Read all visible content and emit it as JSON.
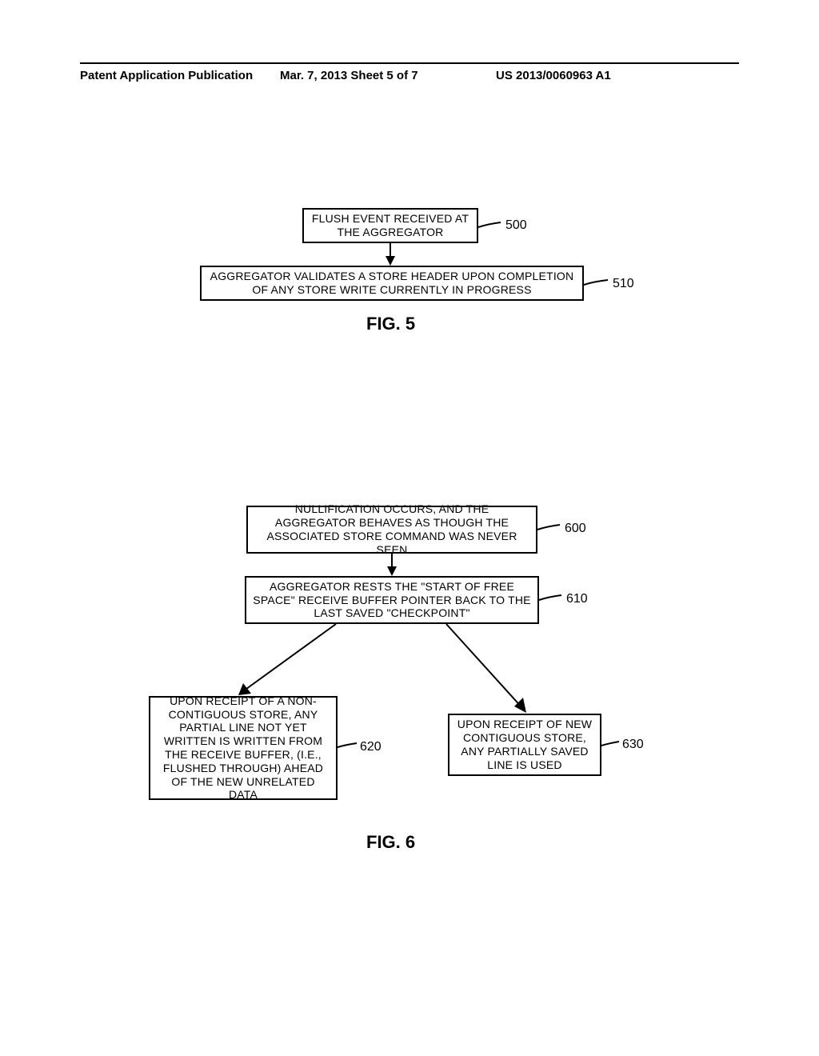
{
  "header": {
    "left": "Patent Application Publication",
    "mid": "Mar. 7, 2013  Sheet 5 of 7",
    "right": "US 2013/0060963 A1"
  },
  "fig5": {
    "box500": "FLUSH EVENT RECEIVED AT THE AGGREGATOR",
    "ref500": "500",
    "box510": "AGGREGATOR VALIDATES A STORE HEADER UPON COMPLETION OF ANY STORE WRITE CURRENTLY IN PROGRESS",
    "ref510": "510",
    "label": "FIG. 5"
  },
  "fig6": {
    "box600": "NULLIFICATION OCCURS, AND THE AGGREGATOR BEHAVES AS THOUGH THE ASSOCIATED STORE COMMAND WAS NEVER SEEN",
    "ref600": "600",
    "box610": "AGGREGATOR RESTS THE \"START OF FREE SPACE\" RECEIVE BUFFER POINTER BACK TO THE LAST SAVED \"CHECKPOINT\"",
    "ref610": "610",
    "box620": "UPON RECEIPT OF A NON-CONTIGUOUS STORE, ANY PARTIAL LINE NOT YET WRITTEN IS WRITTEN FROM THE RECEIVE BUFFER, (i.e., FLUSHED THROUGH) AHEAD OF THE NEW UNRELATED DATA",
    "ref620": "620",
    "box630": "UPON RECEIPT OF NEW CONTIGUOUS STORE, ANY PARTIALLY SAVED LINE IS USED",
    "ref630": "630",
    "label": "FIG. 6"
  }
}
